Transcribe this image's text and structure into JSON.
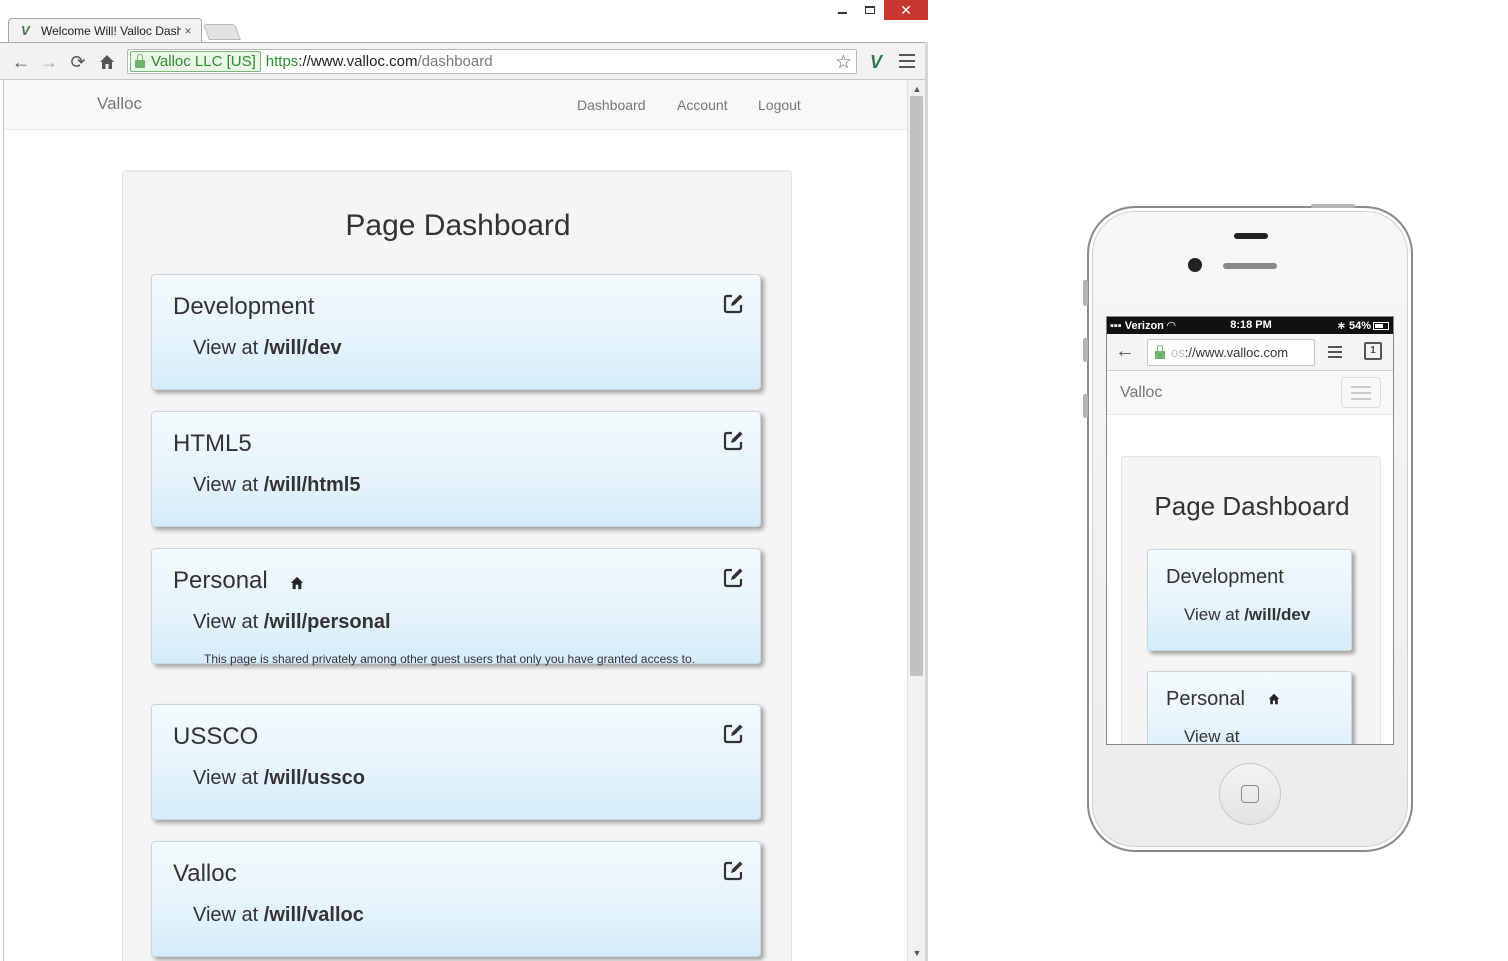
{
  "window": {
    "tab_title": "Welcome Will! Valloc Dash",
    "tab_close": "×",
    "close_glyph": "✕"
  },
  "toolbar": {
    "ev_label": "Valloc LLC [US]",
    "url_scheme": "https",
    "url_host": "://www.valloc.com",
    "url_path": "/dashboard"
  },
  "site": {
    "brand": "Valloc",
    "nav": {
      "dashboard": "Dashboard",
      "account": "Account",
      "logout": "Logout"
    },
    "page_title": "Page Dashboard",
    "view_prefix": "View at",
    "cards": [
      {
        "title": "Development",
        "path": "/will/dev",
        "home": false,
        "note": ""
      },
      {
        "title": "HTML5",
        "path": "/will/html5",
        "home": false,
        "note": ""
      },
      {
        "title": "Personal",
        "path": "/will/personal",
        "home": true,
        "note": "This page is shared privately among other guest users that only you have granted access to."
      },
      {
        "title": "USSCO",
        "path": "/will/ussco",
        "home": false,
        "note": ""
      },
      {
        "title": "Valloc",
        "path": "/will/valloc",
        "home": false,
        "note": ""
      }
    ]
  },
  "phone": {
    "carrier": "Verizon",
    "time": "8:18 PM",
    "battery": "54%",
    "omni_fade": "os",
    "omni_text": "://www.valloc.com",
    "tabs_count": "1",
    "brand": "Valloc",
    "page_title": "Page Dashboard",
    "cards": [
      {
        "title": "Development",
        "view_prefix": "View at",
        "path": "/will/dev"
      },
      {
        "title": "Personal",
        "view_prefix": "View at",
        "path": ""
      }
    ]
  },
  "colors": {
    "card_top": "#f3fafd",
    "card_bottom": "#d4ecfa",
    "ev_green": "#2e8b2e",
    "close_red": "#c7372f"
  }
}
